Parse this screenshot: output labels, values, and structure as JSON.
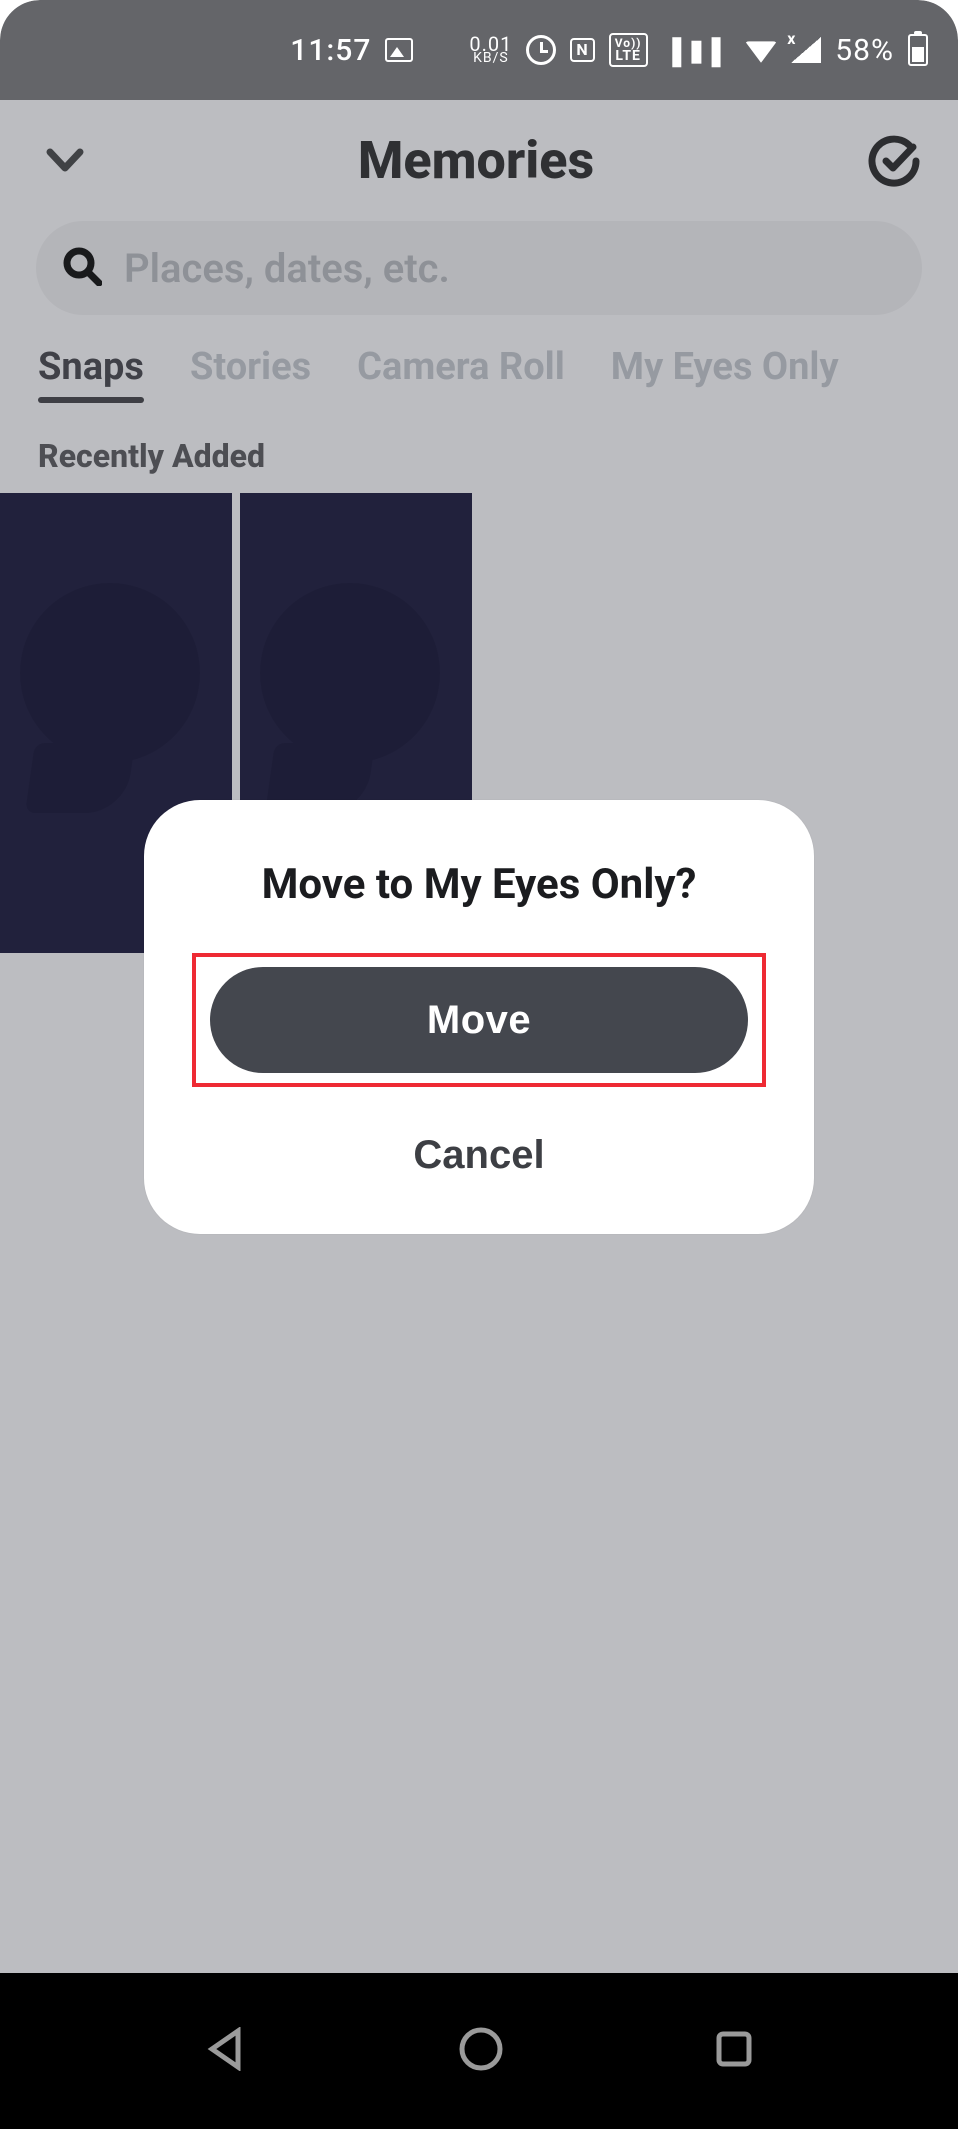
{
  "statusbar": {
    "time": "11:57",
    "data_rate_value": "0.01",
    "data_rate_unit": "KB/S",
    "n_badge": "N",
    "volte_top": "Vo))",
    "volte_bot": "LTE",
    "cell_x": "x",
    "battery_pct": "58%"
  },
  "header": {
    "title": "Memories"
  },
  "search": {
    "placeholder": "Places, dates, etc."
  },
  "tabs": [
    {
      "label": "Snaps",
      "active": true
    },
    {
      "label": "Stories",
      "active": false
    },
    {
      "label": "Camera Roll",
      "active": false
    },
    {
      "label": "My Eyes Only",
      "active": false
    }
  ],
  "section": {
    "recently_added": "Recently Added"
  },
  "modal": {
    "title": "Move to My Eyes Only?",
    "move_label": "Move",
    "cancel_label": "Cancel"
  }
}
